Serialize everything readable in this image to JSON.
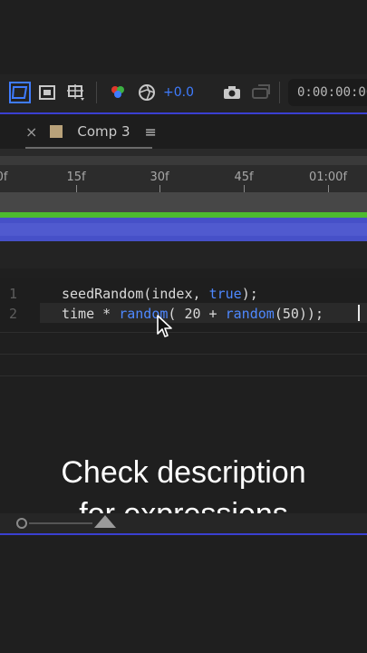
{
  "toolbar": {
    "zoom_value": "+0.0",
    "timecode": "0:00:00:00"
  },
  "tab": {
    "close": "×",
    "title": "Comp 3",
    "menu": "≡"
  },
  "ruler": {
    "ticks": [
      "0f",
      "15f",
      "30f",
      "45f",
      "01:00f"
    ]
  },
  "editor": {
    "line_numbers": [
      "1",
      "2"
    ],
    "line1": {
      "fn": "seedRandom(index, ",
      "kw": "true",
      "end": ");"
    },
    "line2": {
      "a": "time * ",
      "kw1": "random",
      "b": "( 20 + ",
      "kw2": "random",
      "c": "(50));"
    }
  },
  "caption": {
    "line1": "Check description",
    "line2": "for expressions"
  },
  "colors": {
    "accent_blue": "#3a3fd1",
    "layer_purple": "#4650c8",
    "work_green": "#4dbb2f",
    "keyword_blue": "#4e88ff"
  }
}
